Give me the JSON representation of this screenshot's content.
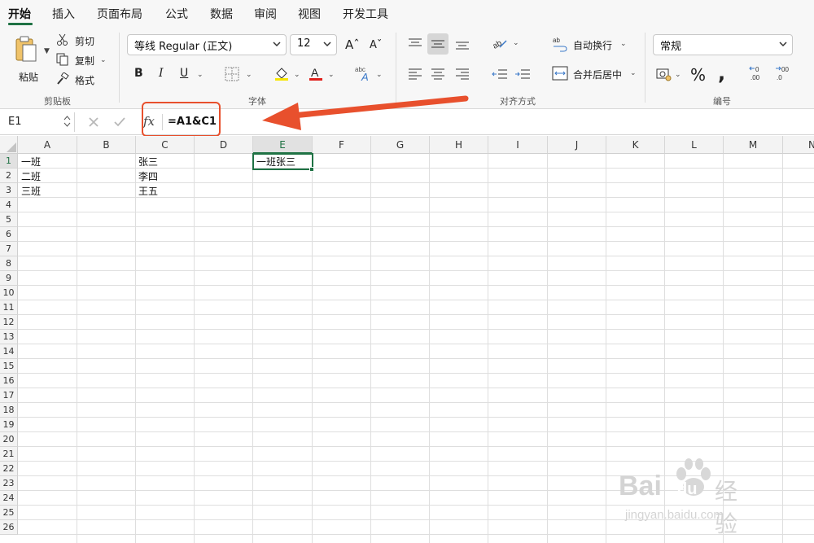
{
  "tabs": [
    "开始",
    "插入",
    "页面布局",
    "公式",
    "数据",
    "审阅",
    "视图",
    "开发工具"
  ],
  "clipboard": {
    "paste": "粘贴",
    "cut": "剪切",
    "copy": "复制",
    "format": "格式",
    "label": "剪贴板"
  },
  "font": {
    "family": "等线 Regular (正文)",
    "size": "12",
    "label": "字体",
    "bold": "B",
    "italic": "I",
    "underline": "U"
  },
  "alignment": {
    "wrap": "自动换行",
    "merge": "合并后居中",
    "label": "对齐方式"
  },
  "number": {
    "format": "常规",
    "label": "编号",
    "percent": "%",
    "comma": ","
  },
  "formula_bar": {
    "name_box": "E1",
    "fx": "fx",
    "formula": "=A1&C1"
  },
  "columns": [
    "A",
    "B",
    "C",
    "D",
    "E",
    "F",
    "G",
    "H",
    "I",
    "J",
    "K",
    "L",
    "M",
    "N"
  ],
  "rows": [
    "1",
    "2",
    "3",
    "4",
    "5",
    "6",
    "7",
    "8",
    "9",
    "10",
    "11",
    "12",
    "13",
    "14",
    "15",
    "16",
    "17",
    "18",
    "19",
    "20",
    "21",
    "22",
    "23",
    "24",
    "25",
    "26"
  ],
  "cells": {
    "A1": "一班",
    "A2": "二班",
    "A3": "三班",
    "C1": "张三",
    "C2": "李四",
    "C3": "王五",
    "E1": "一班张三"
  },
  "watermark": {
    "brand": "Bai",
    "brand2": "du",
    "product": "经验",
    "url": "jingyan.baidu.com"
  },
  "colors": {
    "accent": "#1f7244",
    "highlight": "#e8502d"
  }
}
